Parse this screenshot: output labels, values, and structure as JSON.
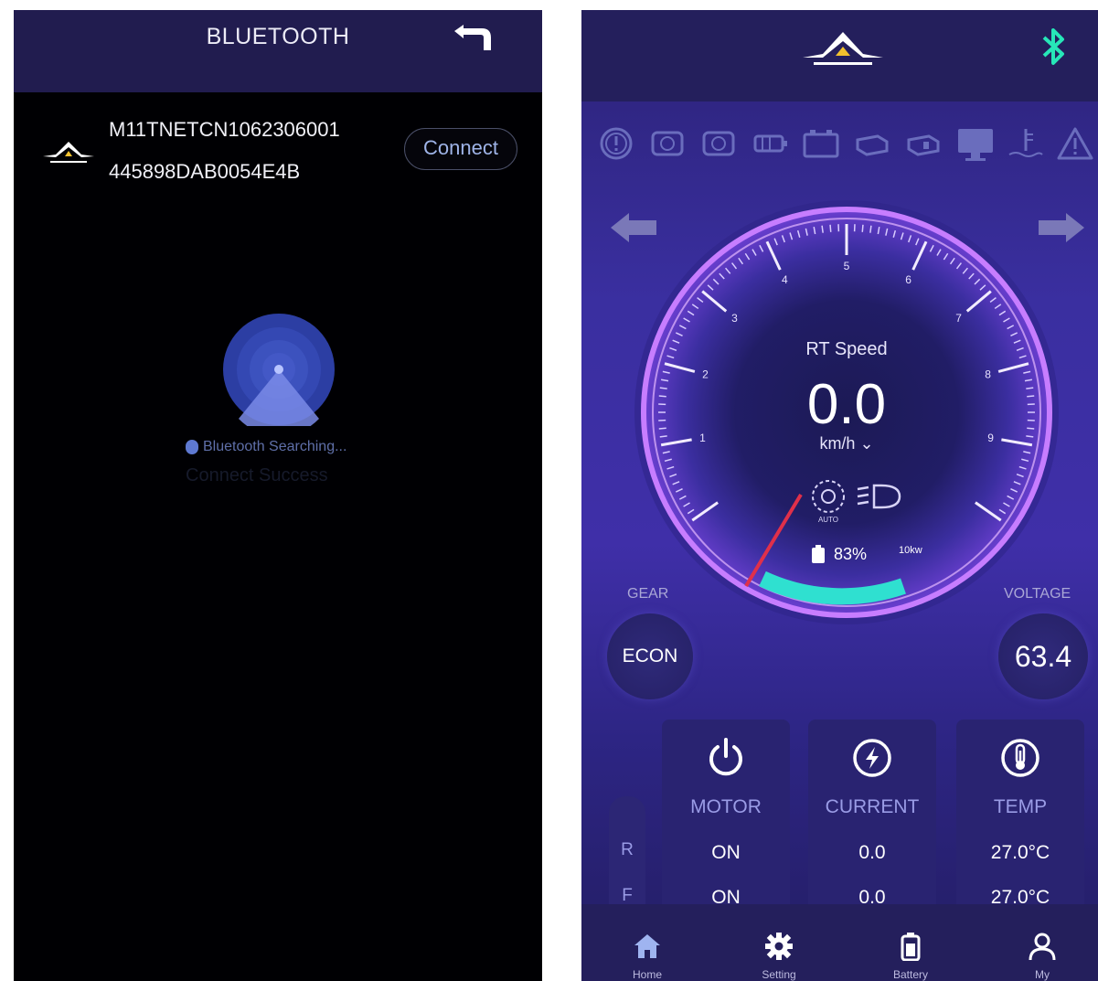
{
  "bluetooth_screen": {
    "title": "BLUETOOTH",
    "device": {
      "name": "M11TNETCN1062306001",
      "mac": "445898DAB0054E4B",
      "connect_label": "Connect"
    },
    "searching_text": "Bluetooth Searching...",
    "connect_success_text": "Connect Success"
  },
  "dashboard": {
    "speed_label": "RT Speed",
    "speed_value": "0.0",
    "speed_unit": "km/h",
    "speed_unit_dropdown_icon": "chevron-down-icon",
    "battery_percent": "83%",
    "power_label": "10kw",
    "auto_label": "AUTO",
    "dial_ticks": [
      "1",
      "2",
      "3",
      "4",
      "5",
      "6",
      "7",
      "8",
      "9"
    ],
    "gear_label": "GEAR",
    "gear_value": "ECON",
    "voltage_label": "VOLTAGE",
    "voltage_value": "63.4",
    "rf": {
      "r": "R",
      "f": "F"
    },
    "cards": [
      {
        "label": "MOTOR",
        "v1": "ON",
        "v2": "ON",
        "icon": "power-icon"
      },
      {
        "label": "CURRENT",
        "v1": "0.0",
        "v2": "0.0",
        "icon": "lightning-icon"
      },
      {
        "label": "TEMP",
        "v1": "27.0°C",
        "v2": "27.0°C",
        "icon": "thermometer-icon"
      }
    ],
    "nav": [
      {
        "label": "Home",
        "icon": "home-icon"
      },
      {
        "label": "Setting",
        "icon": "gear-icon"
      },
      {
        "label": "Battery",
        "icon": "battery-icon"
      },
      {
        "label": "My",
        "icon": "user-icon"
      }
    ],
    "colors": {
      "accent_cyan": "#2fe0d0",
      "bluetooth_green": "#27e6b8",
      "needle_red": "#e0304a",
      "dial_glow": "#c77dff"
    }
  }
}
